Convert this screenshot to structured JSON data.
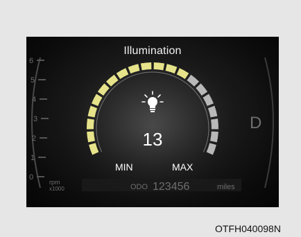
{
  "screen": {
    "title": "Illumination",
    "level": 13,
    "level_max": 20,
    "min_label": "MIN",
    "max_label": "MAX",
    "icon": "light-bulb-icon",
    "caption": "OTFH040098N"
  },
  "tachometer": {
    "ticks": [
      "6",
      "5",
      "4",
      "3",
      "2",
      "1",
      "0"
    ],
    "unit_top": "rpm",
    "unit_bottom": "x1000"
  },
  "odometer": {
    "label": "ODO",
    "value": "123456",
    "unit": "miles"
  },
  "gear": "D",
  "colors": {
    "active_segment": "#e6e38a",
    "inactive_segment": "#b8b8b8",
    "panel": "#111111"
  }
}
